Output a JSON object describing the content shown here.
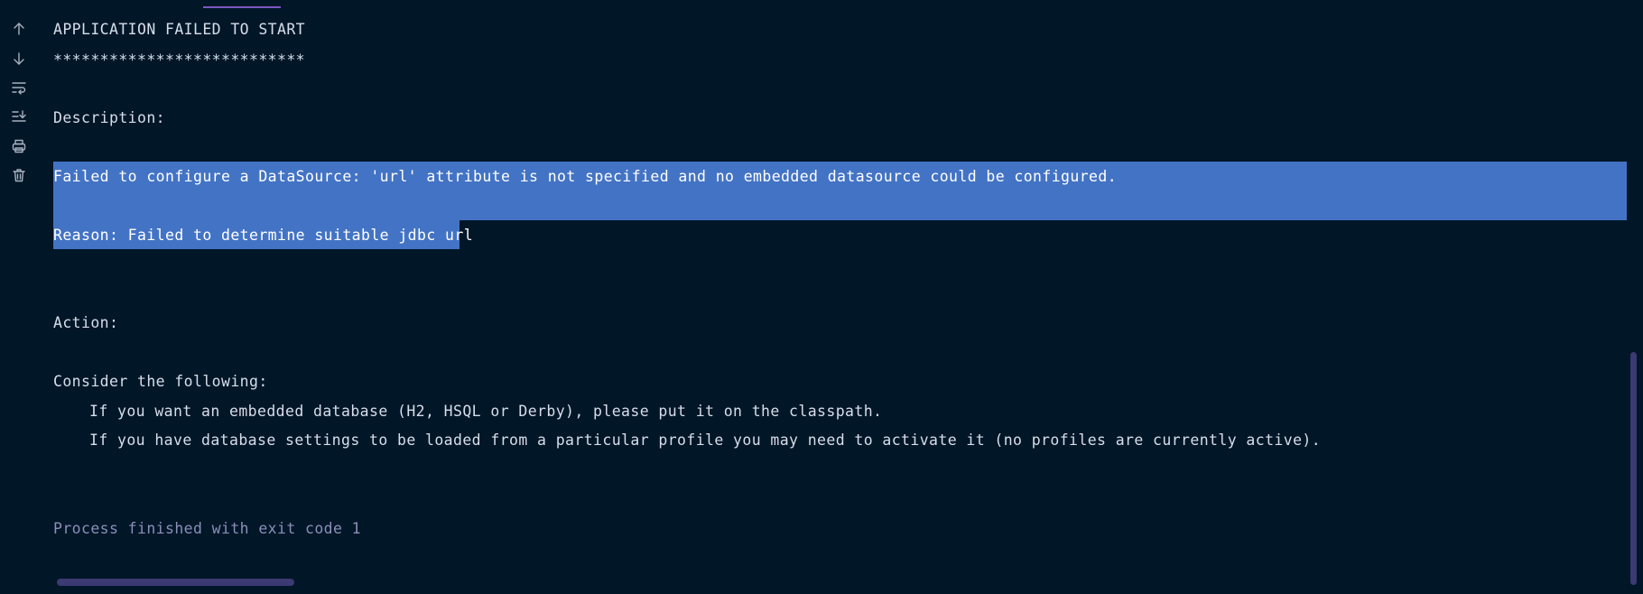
{
  "toolbar": {
    "icons": [
      "arrow-up-icon",
      "arrow-down-icon",
      "soft-wrap-icon",
      "scroll-to-end-icon",
      "print-icon",
      "trash-icon"
    ]
  },
  "output": {
    "heading": "APPLICATION FAILED TO START",
    "stars": "***************************",
    "description_label": "Description:",
    "error_message": "Failed to configure a DataSource: 'url' attribute is not specified and no embedded datasource could be configured.",
    "reason": "Reason: Failed to determine suitable jdbc url",
    "action_label": "Action:",
    "consider": "Consider the following:",
    "suggestion_1": "If you want an embedded database (H2, HSQL or Derby), please put it on the classpath.",
    "suggestion_2": "If you have database settings to be loaded from a particular profile you may need to activate it (no profiles are currently active).",
    "process_finished": "Process finished with exit code 1"
  },
  "colors": {
    "background": "#011627",
    "text": "#d6deeb",
    "selection": "#4373c4",
    "process_text": "#8a8fb8",
    "scrollbar": "#3b3a73"
  }
}
